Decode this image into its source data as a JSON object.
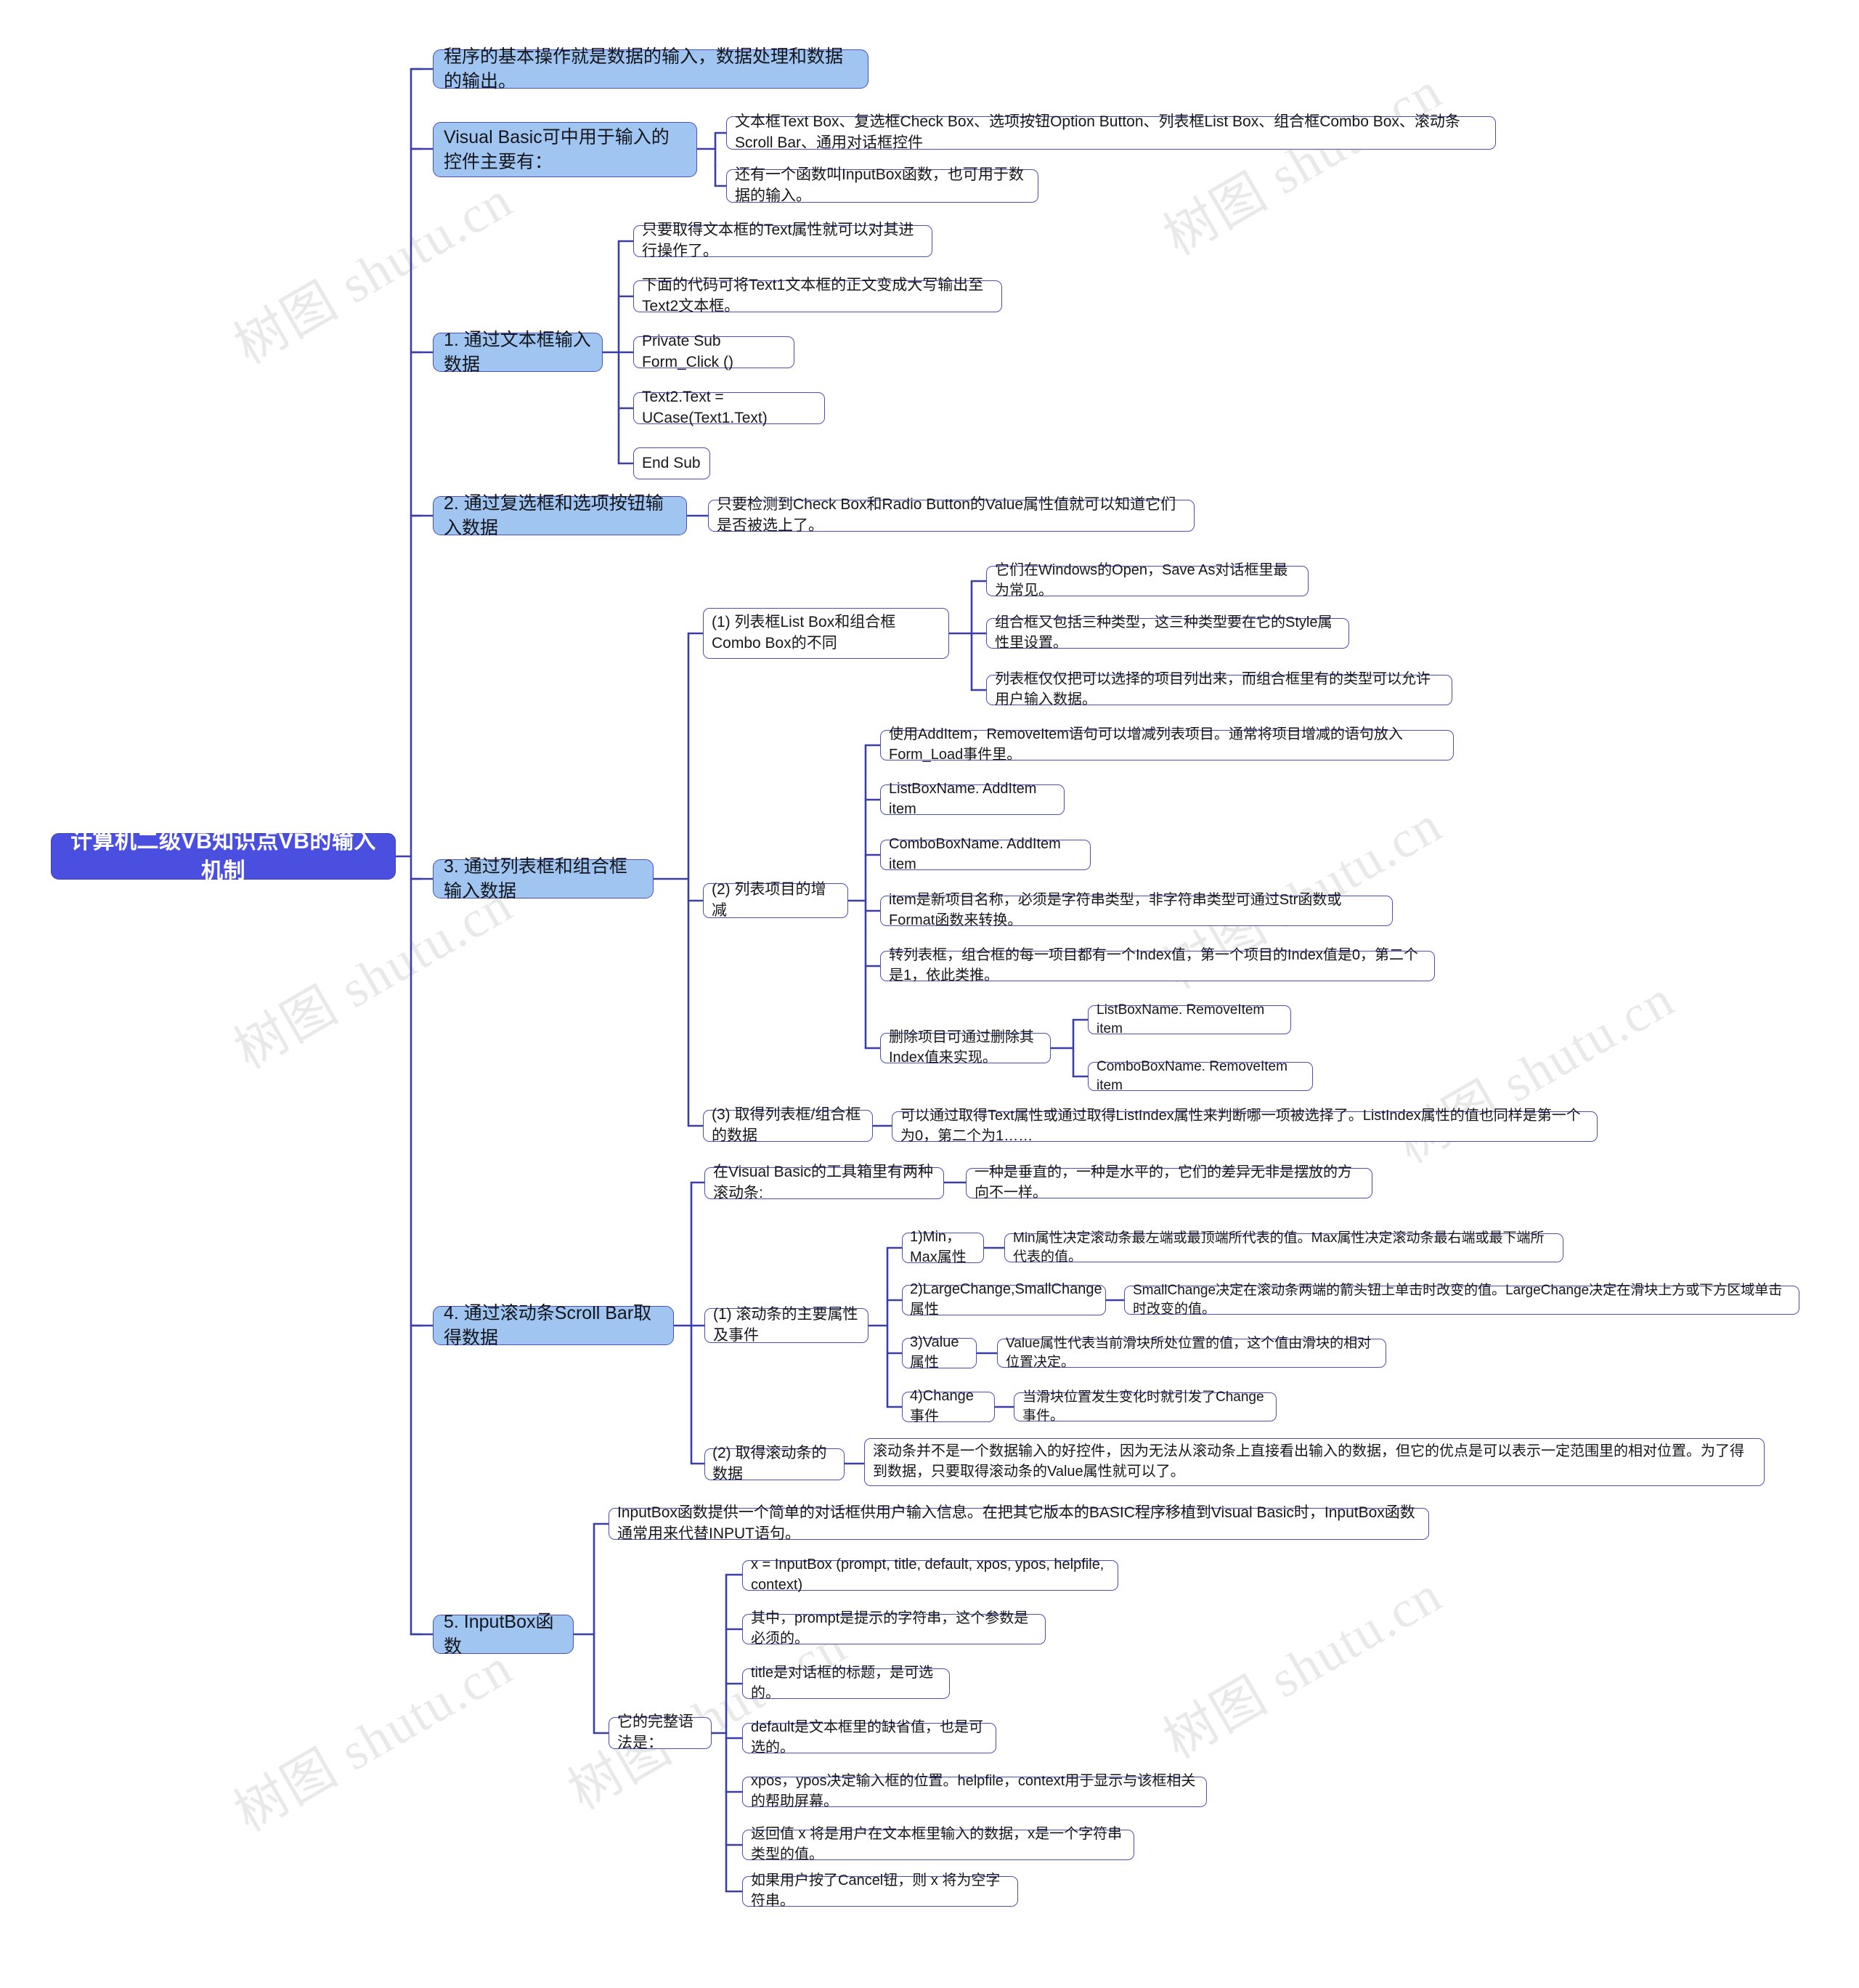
{
  "title": "计算机二级VB知识点VB的输入机制",
  "watermarks": [
    "树图 shutu.cn",
    "树图 shutu.cn",
    "树图 shutu.cn",
    "树图 shutu.cn",
    "树图 shutu.cn",
    "树图 shutu.cn",
    "树图 shutu.cn",
    "树图 shutu.cn"
  ],
  "colors": {
    "root_fill": "#4A4FE0",
    "root_text": "#FFFFFF",
    "level1_fill": "#9FC5F0",
    "node_border": "#4A4FC0",
    "node_fill": "#FFFFFF",
    "node_text": "#16161D",
    "edge": "#3A3FA8",
    "background": "#FFFFFF"
  },
  "root": {
    "label": "计算机二级VB知识点VB的输入机制"
  },
  "nodes": {
    "intro": "程序的基本操作就是数据的输入，数据处理和数据的输出。",
    "controls_title": "Visual Basic可中用于输入的控件主要有：",
    "controls_list": "文本框Text Box、复选框Check Box、选项按钮Option Button、列表框List Box、组合框Combo Box、滚动条Scroll Bar、通用对话框控件",
    "controls_inputbox": "还有一个函数叫InputBox函数，也可用于数据的输入。",
    "s1_title": "1. 通过文本框输入数据",
    "s1_a": "只要取得文本框的Text属性就可以对其进行操作了。",
    "s1_b": "下面的代码可将Text1文本框的正文变成大写输出至Text2文本框。",
    "s1_c": "Private Sub Form_Click ()",
    "s1_d": "Text2.Text = UCase(Text1.Text)",
    "s1_e": "End Sub",
    "s2_title": "2. 通过复选框和选项按钮输入数据",
    "s2_a": "只要检测到Check Box和Radio Button的Value属性值就可以知道它们是否被选上了。",
    "s3_title": "3. 通过列表框和组合框输入数据",
    "s3_1_title": "(1) 列表框List Box和组合框Combo Box的不同",
    "s3_1_a": "它们在Windows的Open，Save As对话框里最为常见。",
    "s3_1_b": "组合框又包括三种类型，这三种类型要在它的Style属性里设置。",
    "s3_1_c": "列表框仅仅把可以选择的项目列出来，而组合框里有的类型可以允许用户输入数据。",
    "s3_2_title": "(2) 列表项目的增减",
    "s3_2_a": "使用AddItem，RemoveItem语句可以增减列表项目。通常将项目增减的语句放入Form_Load事件里。",
    "s3_2_b": "ListBoxName. AddItem item",
    "s3_2_c": "ComboBoxName. AddItem item",
    "s3_2_d": "item是新项目名称，必须是字符串类型，非字符串类型可通过Str函数或Format函数来转换。",
    "s3_2_e": "转列表框，组合框的每一项目都有一个Index值，第一个项目的Index值是0，第二个是1，依此类推。",
    "s3_2_f": "删除项目可通过删除其Index值来实现。",
    "s3_2_f1": "ListBoxName. RemoveItem item",
    "s3_2_f2": "ComboBoxName. RemoveItem item",
    "s3_3_title": "(3) 取得列表框/组合框的数据",
    "s3_3_a": "可以通过取得Text属性或通过取得ListIndex属性来判断哪一项被选择了。ListIndex属性的值也同样是第一个为0，第二个为1……",
    "s4_title": "4. 通过滚动条Scroll Bar取得数据",
    "s4_head": "在Visual Basic的工具箱里有两种滚动条:",
    "s4_head_a": "一种是垂直的，一种是水平的，它们的差异无非是摆放的方向不一样。",
    "s4_1_title": "(1) 滚动条的主要属性及事件",
    "s4_1_a": "1)Min，Max属性",
    "s4_1_a_desc": "Min属性决定滚动条最左端或最顶端所代表的值。Max属性决定滚动条最右端或最下端所代表的值。",
    "s4_1_b": "2)LargeChange,SmallChange属性",
    "s4_1_b_desc": "SmallChange决定在滚动条两端的箭头钮上单击时改变的值。LargeChange决定在滑块上方或下方区域单击时改变的值。",
    "s4_1_c": "3)Value属性",
    "s4_1_c_desc": "Value属性代表当前滑块所处位置的值，这个值由滑块的相对位置决定。",
    "s4_1_d": "4)Change事件",
    "s4_1_d_desc": "当滑块位置发生变化时就引发了Change事件。",
    "s4_2_title": "(2) 取得滚动条的数据",
    "s4_2_a": "滚动条并不是一个数据输入的好控件，因为无法从滚动条上直接看出输入的数据，但它的优点是可以表示一定范围里的相对位置。为了得到数据，只要取得滚动条的Value属性就可以了。",
    "s5_title": "5. InputBox函数",
    "s5_a": "InputBox函数提供一个简单的对话框供用户输入信息。在把其它版本的BASIC程序移植到Visual Basic时，InputBox函数通常用来代替INPUT语句。",
    "s5_syntax_title": "它的完整语法是：",
    "s5_b": "x = InputBox (prompt, title, default, xpos, ypos, helpfile, context)",
    "s5_c": "其中，prompt是提示的字符串，这个参数是必须的。",
    "s5_d": "title是对话框的标题，是可选的。",
    "s5_e": "default是文本框里的缺省值，也是可选的。",
    "s5_f": "xpos，ypos决定输入框的位置。helpfile，context用于显示与该框相关的帮助屏幕。",
    "s5_g": "返回值 x 将是用户在文本框里输入的数据，x是一个字符串类型的值。",
    "s5_h": "如果用户按了Cancel钮，则 x 将为空字符串。"
  }
}
